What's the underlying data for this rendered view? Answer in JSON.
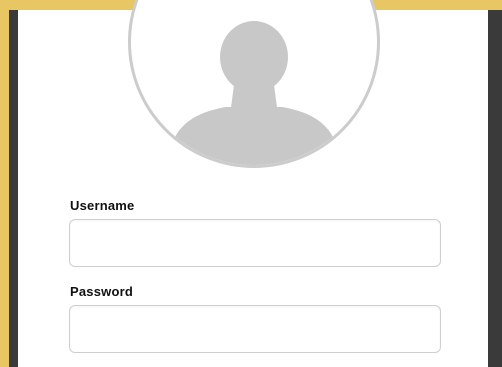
{
  "login": {
    "avatar_icon": "user-silhouette-icon",
    "username_label": "Username",
    "username_value": "",
    "password_label": "Password",
    "password_value": ""
  },
  "colors": {
    "accent_border": "#e8c664",
    "dark_border": "#3a3a3a",
    "avatar_fill": "#c8c8c8",
    "avatar_ring": "#cccccc"
  }
}
